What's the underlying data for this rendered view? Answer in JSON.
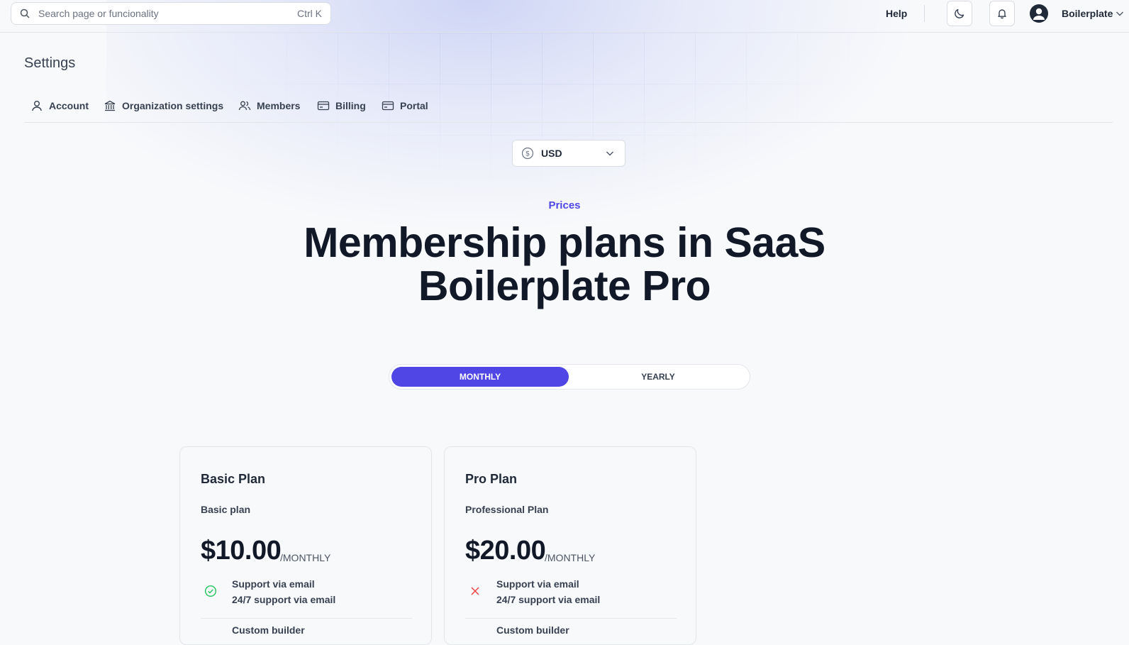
{
  "topbar": {
    "search_placeholder": "Search page or funcionality",
    "search_shortcut": "Ctrl K",
    "help_label": "Help",
    "user_name": "Boilerplate"
  },
  "settings": {
    "title": "Settings",
    "tabs": [
      {
        "label": "Account",
        "icon": "user-icon"
      },
      {
        "label": "Organization settings",
        "icon": "building-icon"
      },
      {
        "label": "Members",
        "icon": "users-icon"
      },
      {
        "label": "Billing",
        "icon": "credit-card-icon"
      },
      {
        "label": "Portal",
        "icon": "credit-card-icon"
      }
    ]
  },
  "pricing": {
    "currency": "USD",
    "eyebrow": "Prices",
    "headline_line1": "Membership plans in SaaS",
    "headline_line2": "Boilerplate Pro",
    "toggle": {
      "monthly": "MONTHLY",
      "yearly": "YEARLY",
      "selected": "MONTHLY"
    },
    "plans": [
      {
        "name": "Basic Plan",
        "description": "Basic plan",
        "price": "$10.00",
        "period": "/MONTHLY",
        "feature_title": "Support via email",
        "feature_subtitle": "24/7 support via email",
        "feature_included": true,
        "feature2": "Custom builder"
      },
      {
        "name": "Pro Plan",
        "description": "Professional Plan",
        "price": "$20.00",
        "period": "/MONTHLY",
        "feature_title": "Support via email",
        "feature_subtitle": "24/7 support via email",
        "feature_included": false,
        "feature2": "Custom builder"
      }
    ]
  },
  "colors": {
    "accent": "#4f46e5",
    "check": "#22c55e",
    "cross": "#ef4444"
  }
}
